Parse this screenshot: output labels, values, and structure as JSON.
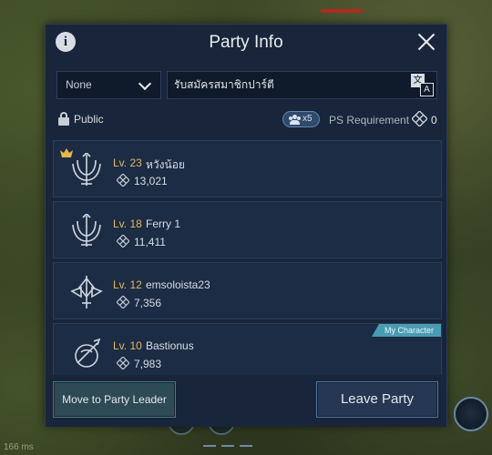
{
  "dialog": {
    "title": "Party Info",
    "filter_select": {
      "value": "None"
    },
    "party_name": {
      "value": "รับสมัครสมาชิกปาร์ตี"
    },
    "visibility": "Public",
    "member_count": "x5",
    "ps_requirement_label": "PS Requirement",
    "ps_requirement_value": "0"
  },
  "members": [
    {
      "level": "Lv. 23",
      "name": "หวังน้อย",
      "cp": "13,021",
      "leader": true,
      "emblem": "trident-emblem-icon"
    },
    {
      "level": "Lv. 18",
      "name": "Ferry 1",
      "cp": "11,411",
      "leader": false,
      "emblem": "trident-emblem-icon"
    },
    {
      "level": "Lv. 12",
      "name": "emsoloista23",
      "cp": "7,356",
      "leader": false,
      "emblem": "spear-emblem-icon"
    },
    {
      "level": "Lv. 10",
      "name": "Bastionus",
      "cp": "7,983",
      "leader": false,
      "emblem": "shield-emblem-icon",
      "tag": "My Character"
    }
  ],
  "footer": {
    "move_leader_label": "Move to Party Leader",
    "leave_label": "Leave Party"
  },
  "hud": {
    "ping": "166 ms"
  },
  "colors": {
    "panel": "#18253a",
    "row": "#1c2c44",
    "level_gold": "#e6b85c",
    "tag_teal": "#4a9cb2"
  }
}
